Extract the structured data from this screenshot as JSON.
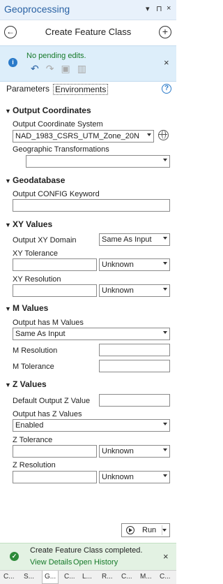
{
  "window": {
    "title": "Geoprocessing",
    "controls": [
      "▾",
      "⊓",
      "×"
    ]
  },
  "header": {
    "title": "Create Feature Class"
  },
  "edit_bar": {
    "message": "No pending edits."
  },
  "tabs": {
    "parameters": "Parameters",
    "environments": "Environments"
  },
  "sections": {
    "output_coordinates": {
      "title": "Output Coordinates",
      "output_coordinate_system_label": "Output Coordinate System",
      "output_coordinate_system_value": "NAD_1983_CSRS_UTM_Zone_20N",
      "geographic_transformations_label": "Geographic Transformations",
      "geographic_transformations_value": ""
    },
    "geodatabase": {
      "title": "Geodatabase",
      "config_keyword_label": "Output CONFIG Keyword",
      "config_keyword_value": ""
    },
    "xy_values": {
      "title": "XY Values",
      "domain_label": "Output XY Domain",
      "domain_value": "Same As Input",
      "tolerance_label": "XY Tolerance",
      "tolerance_value": "",
      "tolerance_unit": "Unknown",
      "resolution_label": "XY Resolution",
      "resolution_value": "",
      "resolution_unit": "Unknown"
    },
    "m_values": {
      "title": "M Values",
      "has_m_label": "Output has M Values",
      "has_m_value": "Same As Input",
      "resolution_label": "M Resolution",
      "resolution_value": "",
      "tolerance_label": "M Tolerance",
      "tolerance_value": ""
    },
    "z_values": {
      "title": "Z Values",
      "default_z_label": "Default Output Z Value",
      "default_z_value": "",
      "has_z_label": "Output has Z Values",
      "has_z_value": "Enabled",
      "tolerance_label": "Z Tolerance",
      "tolerance_value": "",
      "tolerance_unit": "Unknown",
      "resolution_label": "Z Resolution",
      "resolution_value": "",
      "resolution_unit": "Unknown"
    }
  },
  "run_button": {
    "label": "Run"
  },
  "status": {
    "message": "Create Feature Class completed.",
    "view_details": "View Details",
    "open_history": "Open History"
  },
  "bottom_tabs": [
    "C...",
    "S...",
    "G...",
    "C...",
    "L...",
    "R...",
    "C...",
    "M...",
    "C..."
  ],
  "colors": {
    "title_blue": "#2a62a4",
    "edit_bar_bg": "#ddeefa",
    "success_green": "#167a2a",
    "status_bg": "#e3f2e3"
  }
}
